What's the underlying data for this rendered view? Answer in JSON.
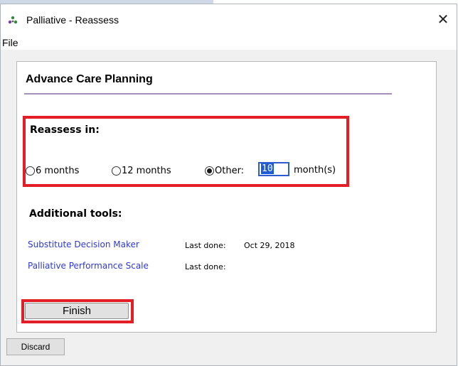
{
  "window": {
    "title": "Palliative - Reassess",
    "close_glyph": "✕",
    "app_icon": "palliative-app-icon"
  },
  "menubar": {
    "file_label": "File"
  },
  "section": {
    "title": "Advance Care Planning"
  },
  "reassess": {
    "label": "Reassess in:",
    "options": [
      {
        "label": "6 months",
        "checked": false
      },
      {
        "label": "12 months",
        "checked": false
      },
      {
        "label": "Other:",
        "checked": true
      }
    ],
    "other_value": "10",
    "other_suffix": "month(s)"
  },
  "tools": {
    "label": "Additional tools:",
    "items": [
      {
        "name": "Substitute Decision Maker",
        "last_done_label": "Last done:",
        "last_done_value": "Oct 29, 2018"
      },
      {
        "name": "Palliative Performance Scale",
        "last_done_label": "Last done:",
        "last_done_value": ""
      }
    ]
  },
  "buttons": {
    "finish": "Finish",
    "discard": "Discard"
  },
  "colors": {
    "highlight": "#e41e26",
    "link": "#2d39d6",
    "section_rule": "#a58fba"
  }
}
